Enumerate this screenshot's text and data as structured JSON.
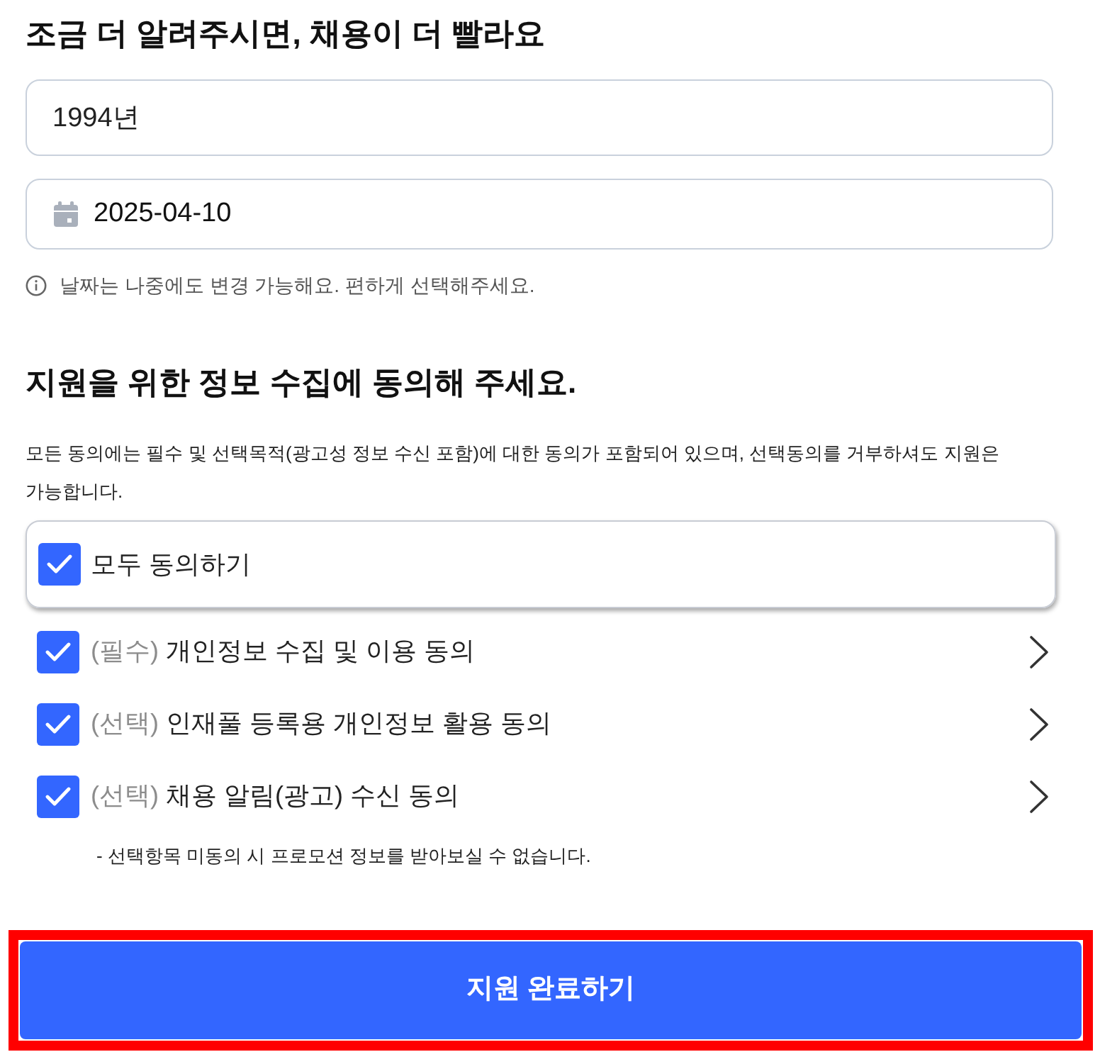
{
  "profile_section": {
    "title": "조금 더 알려주시면, 채용이 더 빨라요",
    "birth_year_field": {
      "value": "1994년"
    },
    "date_field": {
      "value": "2025-04-10"
    },
    "date_hint": "날짜는 나중에도 변경 가능해요. 편하게 선택해주세요."
  },
  "consent_section": {
    "title": "지원을 위한 정보 수집에 동의해 주세요.",
    "description": "모든 동의에는 필수 및 선택목적(광고성 정보 수신 포함)에 대한 동의가 포함되어 있으며, 선택동의를 거부하셔도 지원은 가능합니다.",
    "agree_all": {
      "label": "모두 동의하기",
      "checked": true
    },
    "items": [
      {
        "tag": "(필수)",
        "label": "개인정보 수집 및 이용 동의",
        "checked": true
      },
      {
        "tag": "(선택)",
        "label": "인재풀 등록용 개인정보 활용 동의",
        "checked": true
      },
      {
        "tag": "(선택)",
        "label": "채용 알림(광고) 수신 동의",
        "checked": true
      }
    ],
    "note": "- 선택항목 미동의 시 프로모션 정보를 받아보실 수 없습니다."
  },
  "submit_button": {
    "label": "지원 완료하기",
    "highlighted": true
  }
}
